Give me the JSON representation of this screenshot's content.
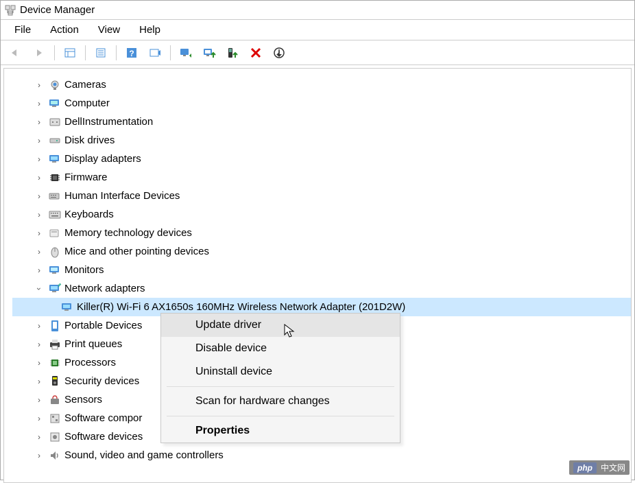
{
  "title": "Device Manager",
  "menu": {
    "file": "File",
    "action": "Action",
    "view": "View",
    "help": "Help"
  },
  "tree": {
    "cameras": "Cameras",
    "computer": "Computer",
    "dellinstrumentation": "DellInstrumentation",
    "diskdrives": "Disk drives",
    "displayadapters": "Display adapters",
    "firmware": "Firmware",
    "hid": "Human Interface Devices",
    "keyboards": "Keyboards",
    "memtech": "Memory technology devices",
    "mice": "Mice and other pointing devices",
    "monitors": "Monitors",
    "netadapters": "Network adapters",
    "netchild": "Killer(R) Wi-Fi 6 AX1650s 160MHz Wireless Network Adapter (201D2W)",
    "portable": "Portable Devices",
    "printqueues": "Print queues",
    "processors": "Processors",
    "security": "Security devices",
    "sensors": "Sensors",
    "softcomp": "Software compor",
    "softdev": "Software devices",
    "sound": "Sound, video and game controllers"
  },
  "context": {
    "update": "Update driver",
    "disable": "Disable device",
    "uninstall": "Uninstall device",
    "scan": "Scan for hardware changes",
    "properties": "Properties"
  },
  "watermark": {
    "php": "php",
    "cn": "中文网"
  }
}
